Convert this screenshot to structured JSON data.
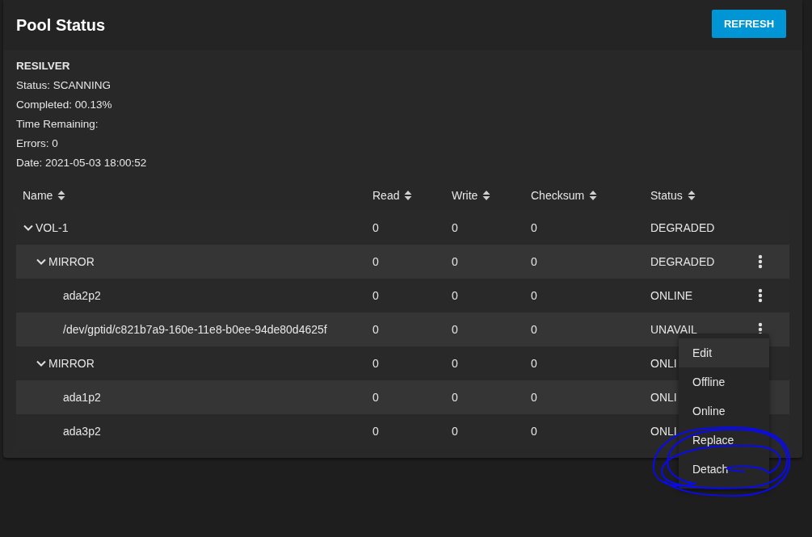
{
  "card": {
    "title": "Pool Status",
    "refresh_button": "REFRESH"
  },
  "scan": {
    "heading": "RESILVER",
    "lines": [
      "Status: SCANNING",
      "Completed: 00.13%",
      "Time Remaining:",
      "Errors: 0",
      "Date: 2021-05-03 18:00:52"
    ]
  },
  "table": {
    "columns": [
      "Name",
      "Read",
      "Write",
      "Checksum",
      "Status"
    ],
    "rows": [
      {
        "name": "VOL-1",
        "read": "0",
        "write": "0",
        "checksum": "0",
        "status": "DEGRADED",
        "expanded": true,
        "has_menu": false,
        "children": [
          {
            "name": "MIRROR",
            "read": "0",
            "write": "0",
            "checksum": "0",
            "status": "DEGRADED",
            "expanded": true,
            "has_menu": true,
            "children": [
              {
                "name": "ada2p2",
                "read": "0",
                "write": "0",
                "checksum": "0",
                "status": "ONLINE",
                "has_menu": true
              },
              {
                "name": "/dev/gptid/c821b7a9-160e-11e8-b0ee-94de80d4625f",
                "read": "0",
                "write": "0",
                "checksum": "0",
                "status": "UNAVAIL",
                "has_menu": true
              }
            ]
          },
          {
            "name": "MIRROR",
            "read": "0",
            "write": "0",
            "checksum": "0",
            "status": "ONLI",
            "expanded": true,
            "has_menu": false,
            "children": [
              {
                "name": "ada1p2",
                "read": "0",
                "write": "0",
                "checksum": "0",
                "status": "ONLI",
                "has_menu": false
              },
              {
                "name": "ada3p2",
                "read": "0",
                "write": "0",
                "checksum": "0",
                "status": "ONLI",
                "has_menu": false
              }
            ]
          }
        ]
      }
    ]
  },
  "context_menu": {
    "items": [
      {
        "label": "Edit",
        "selected": true
      },
      {
        "label": "Offline",
        "selected": false
      },
      {
        "label": "Online",
        "selected": false
      },
      {
        "label": "Replace",
        "selected": false
      },
      {
        "label": "Detach",
        "selected": false
      }
    ]
  },
  "annotation": {
    "kind": "circle"
  }
}
